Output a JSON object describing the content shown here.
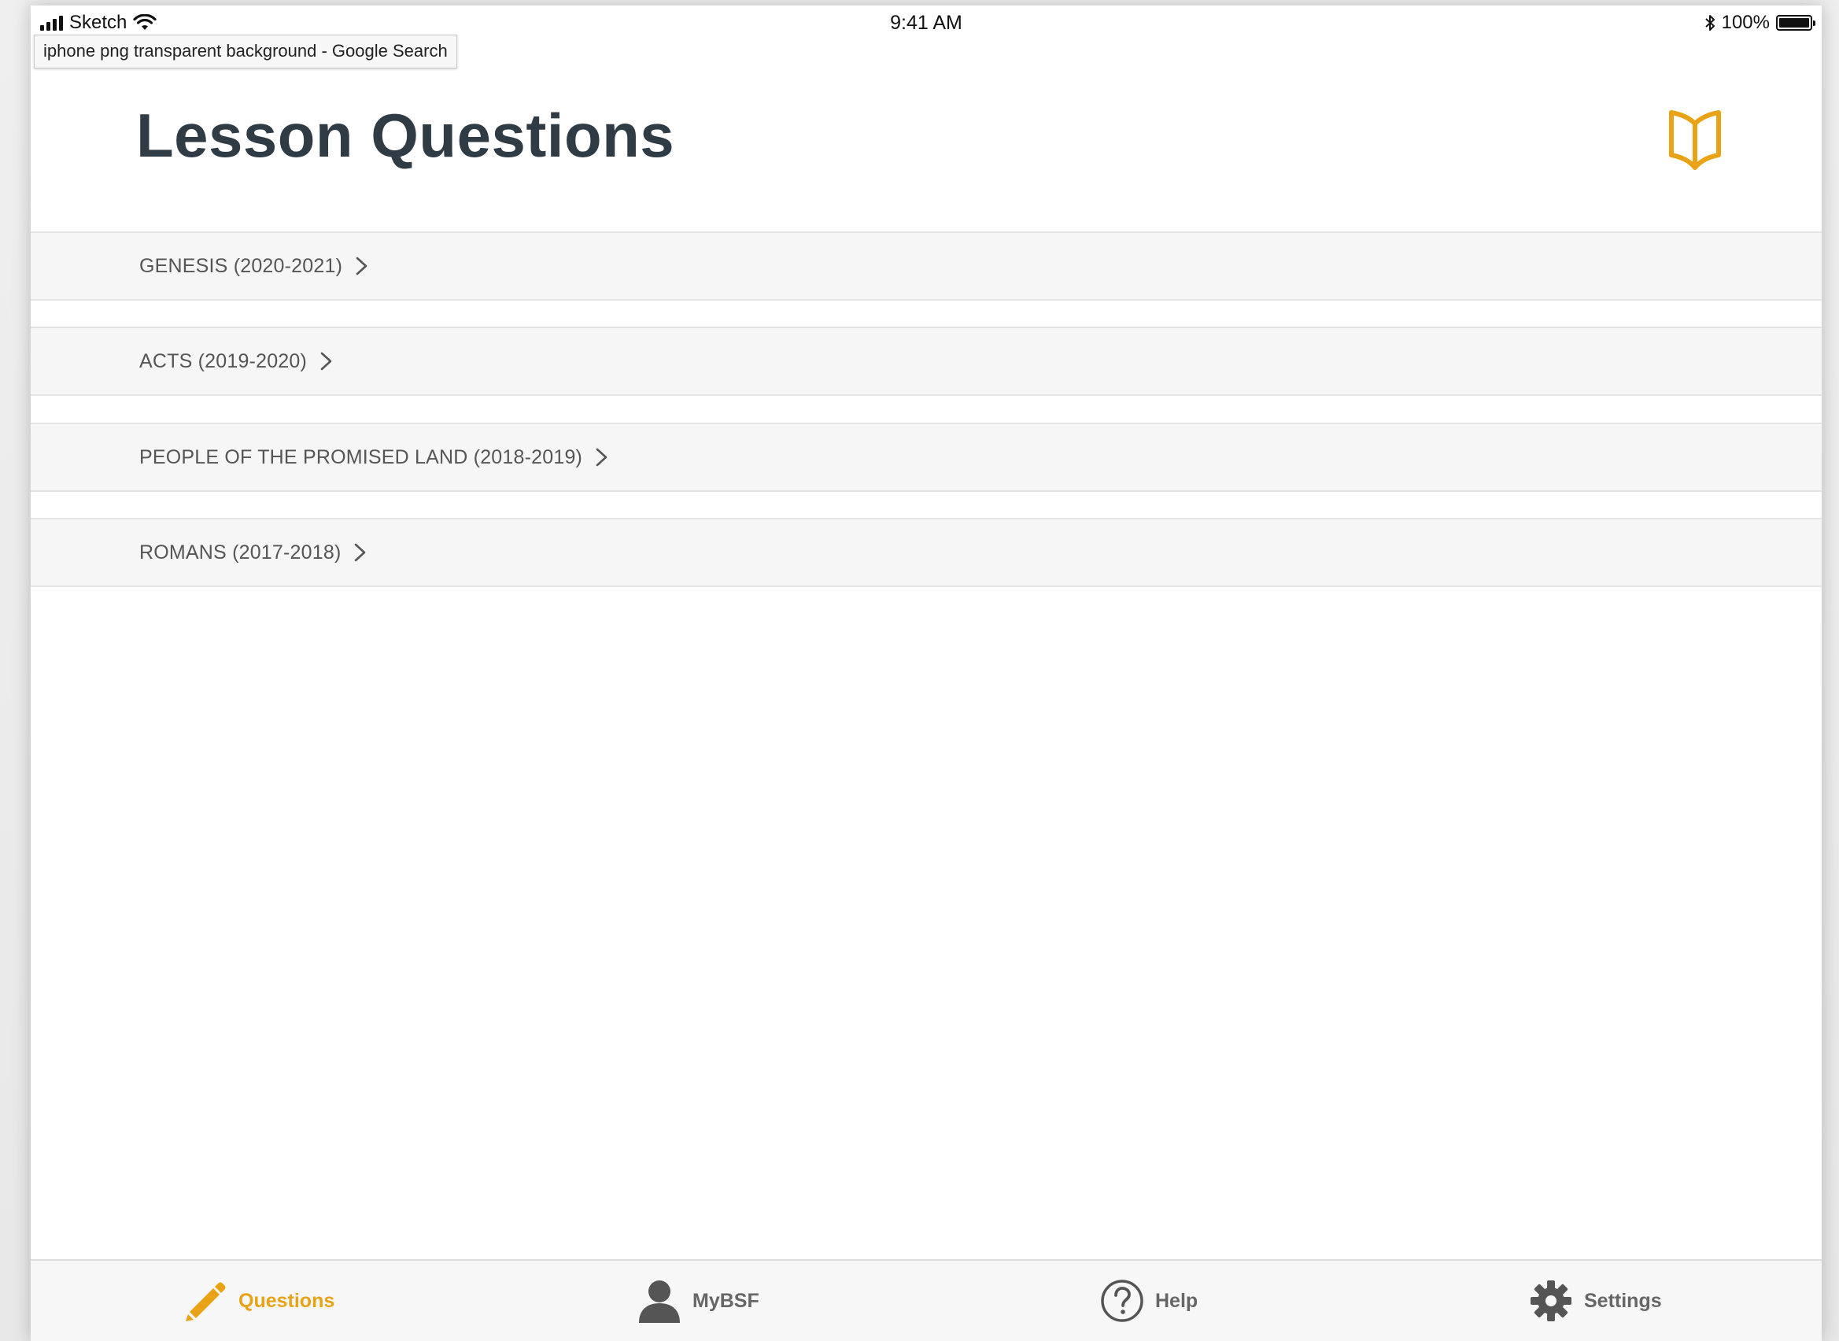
{
  "status_bar": {
    "carrier": "Sketch",
    "time": "9:41 AM",
    "battery": "100%"
  },
  "tooltip": {
    "text": "iphone png transparent background - Google Search"
  },
  "header": {
    "title": "Lesson Questions",
    "icon": "book-open-icon"
  },
  "courses": [
    {
      "label": "GENESIS (2020-2021)"
    },
    {
      "label": "ACTS (2019-2020)"
    },
    {
      "label": "PEOPLE OF THE PROMISED LAND (2018-2019)"
    },
    {
      "label": "ROMANS (2017-2018)"
    }
  ],
  "tab_bar": {
    "active": "Questions",
    "tabs": [
      {
        "label": "Questions",
        "icon": "pencil-icon"
      },
      {
        "label": "MyBSF",
        "icon": "person-icon"
      },
      {
        "label": "Help",
        "icon": "question-circle-icon"
      },
      {
        "label": "Settings",
        "icon": "gear-icon"
      }
    ]
  },
  "colors": {
    "accent": "#e8a317",
    "title": "#2f3b45",
    "list_bg": "#f6f6f6",
    "icon_gray": "#555555"
  }
}
